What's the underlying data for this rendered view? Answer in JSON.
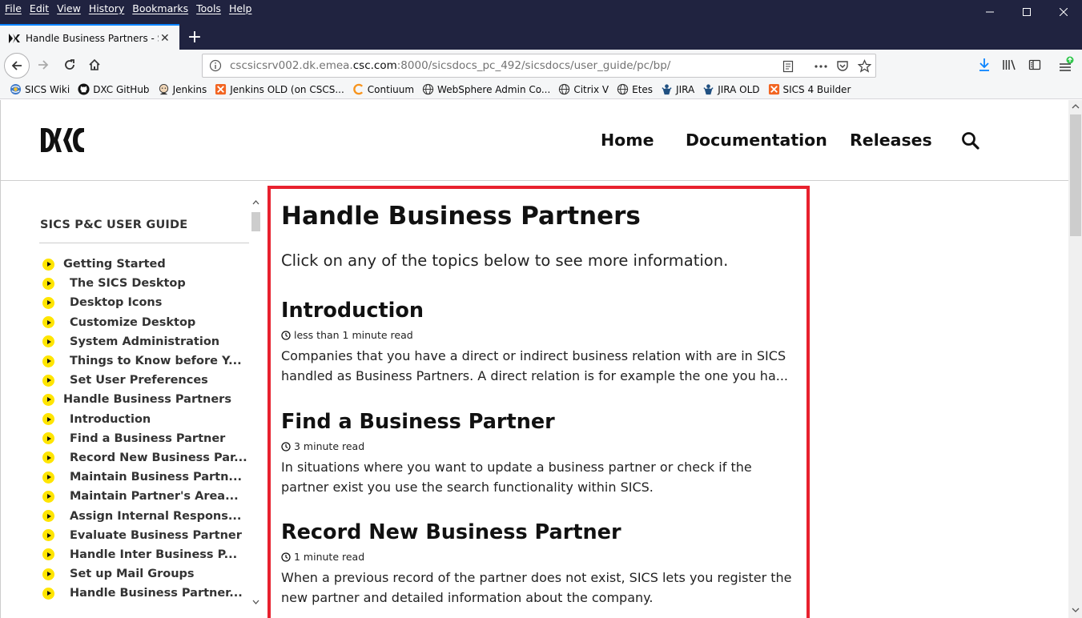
{
  "menu": [
    "File",
    "Edit",
    "View",
    "History",
    "Bookmarks",
    "Tools",
    "Help"
  ],
  "tab": {
    "title": "Handle Business Partners - SICS",
    "close": "✕",
    "new_tab": "+"
  },
  "url": {
    "prefix": "cscsicsrv002.dk.emea.",
    "domain": "csc.com",
    "suffix": ":8000/sicsdocs_pc_492/sicsdocs/user_guide/pc/bp/"
  },
  "bookmarks": [
    {
      "label": "SICS Wiki",
      "icon": "wiki-icon"
    },
    {
      "label": "DXC GitHub",
      "icon": "github-icon"
    },
    {
      "label": "Jenkins",
      "icon": "jenkins-icon"
    },
    {
      "label": "Jenkins OLD (on CSCS...",
      "icon": "folder-icon"
    },
    {
      "label": "Contiuum",
      "icon": "continuum-icon"
    },
    {
      "label": "WebSphere Admin Co...",
      "icon": "globe-icon"
    },
    {
      "label": "Citrix V",
      "icon": "globe-icon"
    },
    {
      "label": "Etes",
      "icon": "globe-icon"
    },
    {
      "label": "JIRA",
      "icon": "jira-icon"
    },
    {
      "label": "JIRA OLD",
      "icon": "jira-icon"
    },
    {
      "label": "SICS 4 Builder",
      "icon": "folder-icon"
    }
  ],
  "site": {
    "logo_text": "DXC",
    "nav": [
      "Home",
      "Documentation",
      "Releases"
    ]
  },
  "sidebar": {
    "title": "SICS P&C USER GUIDE",
    "items": [
      {
        "label": "Getting Started",
        "sub": false
      },
      {
        "label": "The SICS Desktop",
        "sub": true
      },
      {
        "label": "Desktop Icons",
        "sub": true
      },
      {
        "label": "Customize Desktop",
        "sub": true
      },
      {
        "label": "System Administration",
        "sub": true
      },
      {
        "label": "Things to Know before Y...",
        "sub": true
      },
      {
        "label": "Set User Preferences",
        "sub": true
      },
      {
        "label": "Handle Business Partners",
        "sub": false
      },
      {
        "label": "Introduction",
        "sub": true
      },
      {
        "label": "Find a Business Partner",
        "sub": true
      },
      {
        "label": "Record New Business Par...",
        "sub": true
      },
      {
        "label": "Maintain Business Partn...",
        "sub": true
      },
      {
        "label": "Maintain Partner's Area...",
        "sub": true
      },
      {
        "label": "Assign Internal Respons...",
        "sub": true
      },
      {
        "label": "Evaluate Business Partner",
        "sub": true
      },
      {
        "label": "Handle Inter Business P...",
        "sub": true
      },
      {
        "label": "Set up Mail Groups",
        "sub": true
      },
      {
        "label": "Handle Business Partner...",
        "sub": true
      }
    ]
  },
  "content": {
    "title": "Handle Business Partners",
    "intro": "Click on any of the topics below to see more information.",
    "posts": [
      {
        "title": "Introduction",
        "read_time": "less than 1 minute read",
        "excerpt": "Companies that you have a direct or indirect business relation with are in SICS handled as Business Partners. A direct relation is for example the one you ha..."
      },
      {
        "title": "Find a Business Partner",
        "read_time": "3 minute read",
        "excerpt": "In situations where you want to update a business partner or check if the partner exist you use the search functionality within SICS."
      },
      {
        "title": "Record New Business Partner",
        "read_time": "1 minute read",
        "excerpt": "When a previous record of the partner does not exist, SICS lets you register the new partner and detailed information about the company."
      }
    ]
  },
  "colors": {
    "titlebar": "#202340",
    "accent": "#0a84ff",
    "highlight_border": "#e8212e",
    "bullet": "#ffe500"
  }
}
